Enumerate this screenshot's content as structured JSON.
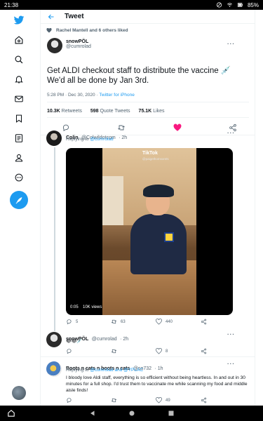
{
  "status_bar": {
    "time": "21:38",
    "battery": "85%"
  },
  "header": {
    "title": "Tweet"
  },
  "liked_by": "Rachel Mantell and 6 others liked",
  "main_tweet": {
    "name": "snowPÖL",
    "handle": "@cumrolad",
    "text": "Get ALDI checkout staff to distribute the vaccine 💉 We'd all be done by Jan 3rd.",
    "timestamp": "5:28 PM · Dec 30, 2020 · ",
    "client": "Twitter for iPhone",
    "retweets": "10.3K",
    "retweets_label": "Retweets",
    "quotes": "598",
    "quotes_label": "Quote Tweets",
    "likes": "75.1K",
    "likes_label": "Likes"
  },
  "replies": [
    {
      "name": "Colin",
      "handle": "@Colwildotcom",
      "age": "· 2h",
      "replying_prefix": "Replying to ",
      "replying_to": "@cumrolad",
      "video": {
        "brand": "TikTok",
        "brand_sub": "@paigethomson01",
        "time": "0:05",
        "views": "10K views"
      },
      "counts": {
        "reply": "5",
        "retweet": "63",
        "like": "440"
      }
    },
    {
      "name": "snowPÖL",
      "handle": "@cumrolad",
      "age": "· 2h",
      "text": "😂😂💉",
      "counts": {
        "reply": "",
        "retweet": "",
        "like": "8"
      }
    },
    {
      "name": "Boots n cats n boots n cats",
      "handle": "@so732",
      "age": "· 1h",
      "replying_prefix": "Replying to ",
      "replying_to": "@cumrolad and @YPLAC",
      "text": "I bloody love Aldi staff, everything is so efficient without being heartless. In and out in 30 minutes for a full shop. I'd trust them to vaccinate me while scanning my food and middle aisle finds!",
      "counts": {
        "reply": "",
        "retweet": "",
        "like": "49"
      }
    }
  ],
  "colors": {
    "accent": "#1d9bf0",
    "like_red": "#f91880",
    "muted": "#536471"
  }
}
